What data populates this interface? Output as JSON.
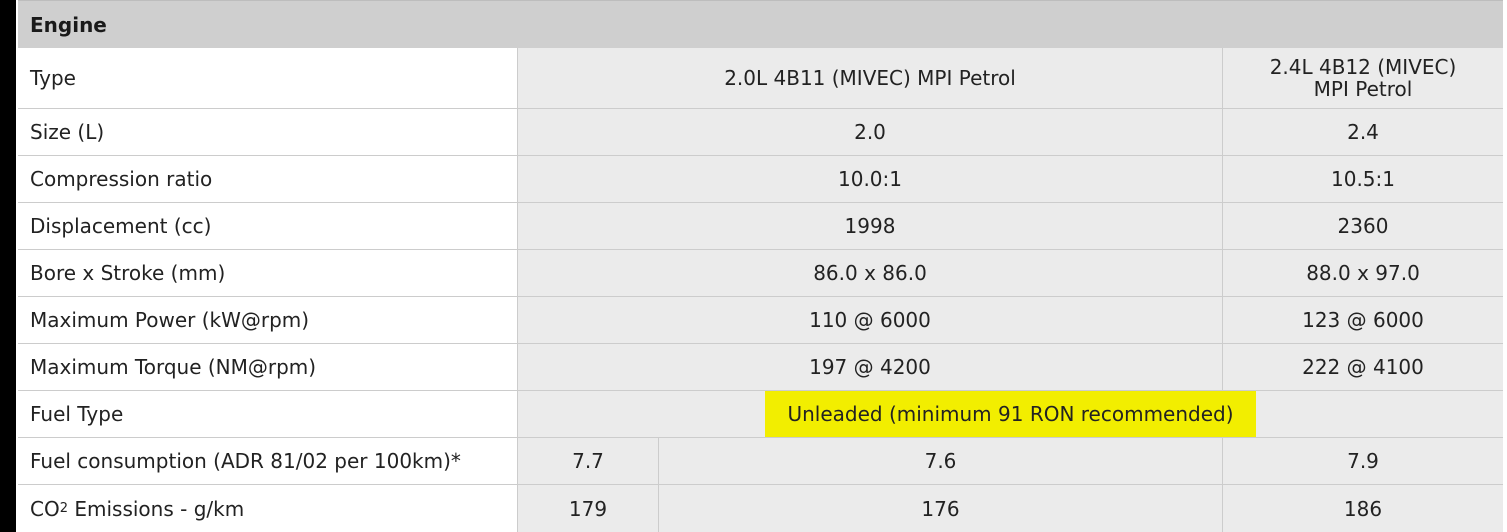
{
  "section": {
    "title": "Engine"
  },
  "rows": {
    "type": {
      "label": "Type",
      "v1": "2.0L 4B11  (MIVEC) MPI Petrol",
      "v2_line1": "2.4L 4B12 (MIVEC)",
      "v2_line2": "MPI Petrol"
    },
    "size": {
      "label": "Size (L)",
      "v1": "2.0",
      "v2": "2.4"
    },
    "compression": {
      "label": "Compression ratio",
      "v1": "10.0:1",
      "v2": "10.5:1"
    },
    "displacement": {
      "label": "Displacement (cc)",
      "v1": "1998",
      "v2": "2360"
    },
    "bore_stroke": {
      "label": "Bore x Stroke (mm)",
      "v1": "86.0 x 86.0",
      "v2": "88.0 x 97.0"
    },
    "power": {
      "label": "Maximum Power (kW@rpm)",
      "v1": "110 @ 6000",
      "v2": "123 @ 6000"
    },
    "torque": {
      "label": "Maximum Torque (NM@rpm)",
      "v1": "197 @ 4200",
      "v2": "222 @ 4100"
    },
    "fuel_type": {
      "label": "Fuel Type",
      "value": "Unleaded (minimum 91 RON recommended)"
    },
    "fuel_consumption": {
      "label": "Fuel consumption (ADR 81/02 per 100km)*",
      "v1": "7.7",
      "v2": "7.6",
      "v3": "7.9"
    },
    "co2": {
      "label_pre": "CO",
      "label_sub": "2",
      "label_post": " Emissions - g/km",
      "v1": "179",
      "v2": "176",
      "v3": "186"
    }
  },
  "colors": {
    "header_bg": "#cfcfcf",
    "value_bg": "#ebebeb",
    "highlight": "#f2ee00",
    "left_bar": "#000000"
  }
}
